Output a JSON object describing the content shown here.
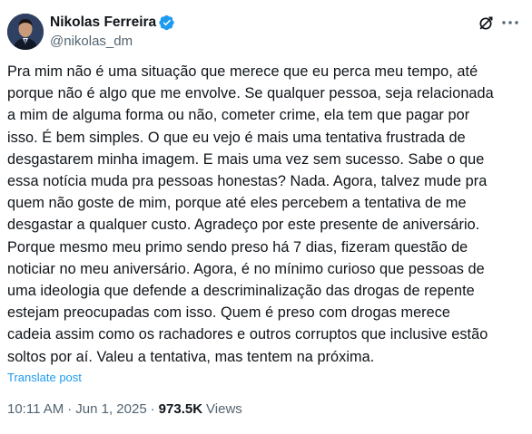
{
  "author": {
    "display_name": "Nikolas Ferreira",
    "handle": "@nikolas_dm",
    "verified_color": "#1d9bf0"
  },
  "tweet": {
    "lines": [
      "Pra mim não é uma situação que merece que eu perca meu tempo, até",
      "porque não é algo que me envolve. Se qualquer pessoa, seja relacionada",
      "a mim de alguma forma ou não, cometer crime, ela tem que pagar por",
      "isso. É bem simples. O que eu vejo é mais uma tentativa frustrada de",
      "desgastarem minha imagem. E mais uma vez sem sucesso. Sabe o que",
      "essa notícia muda pra pessoas honestas? Nada. Agora, talvez mude pra",
      "quem não goste de mim, porque até eles percebem a tentativa de me",
      "desgastar a qualquer custo.  Agradeço por este presente de aniversário.",
      "Porque mesmo meu primo sendo preso há 7 dias, fizeram questão de",
      "noticiar no meu aniversário. Agora, é no mínimo curioso que pessoas de",
      "uma ideologia que defende a descriminalização das drogas de repente",
      "estejam preocupadas com isso. Quem é preso com drogas merece",
      "cadeia assim como os rachadores e outros corruptos que inclusive estão",
      "soltos por aí. Valeu a tentativa, mas tentem na próxima."
    ],
    "translate_label": "Translate post",
    "time": "10:11 AM",
    "separator": "·",
    "date": "Jun 1, 2025",
    "views_count": "973.5K",
    "views_label": "Views"
  },
  "icons": {
    "verified": "verified-badge-icon",
    "grok": "grok-icon",
    "more": "more-options-icon"
  },
  "colors": {
    "text": "#0f1419",
    "secondary": "#536471",
    "link": "#1d9bf0"
  }
}
